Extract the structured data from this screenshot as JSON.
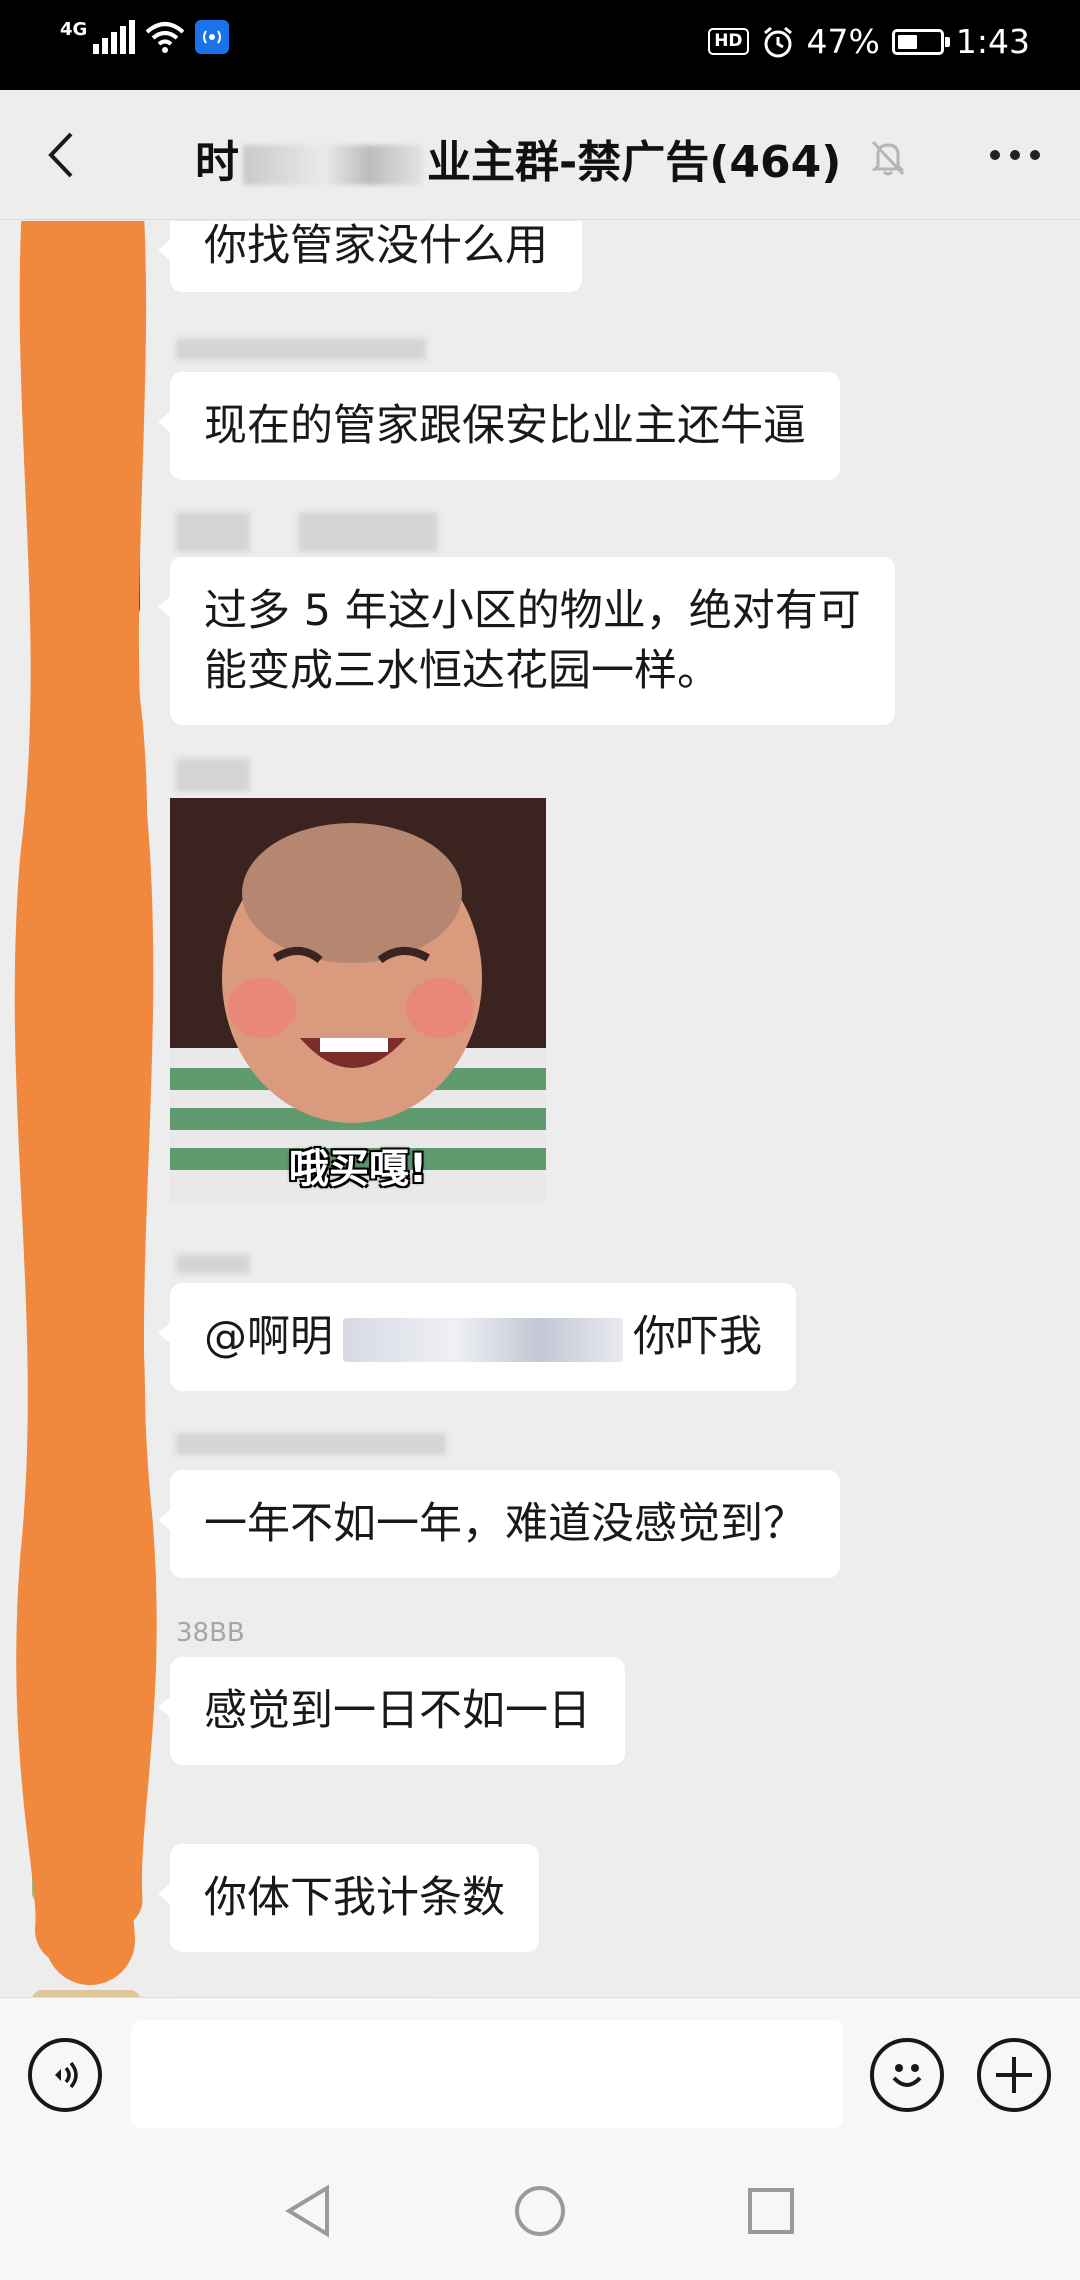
{
  "status_bar": {
    "network": "4G",
    "hd_badge": "HD",
    "battery_percent": "47%",
    "battery_level": 0.47,
    "time": "1:43"
  },
  "header": {
    "title": "时代城业主群-禁广告(464)",
    "title_prefix": "时",
    "title_suffix": "业主群-禁广告(464)",
    "muted": true
  },
  "messages": [
    {
      "sender": "",
      "text": "你找管家没什么用"
    },
    {
      "sender": "",
      "text": "现在的管家跟保安比业主还牛逼"
    },
    {
      "sender": "",
      "text_line1": "过多 5 年这小区的物业，绝对有可",
      "text_line2": "能变成三水恒达花园一样。"
    },
    {
      "sender": "",
      "sticker_caption": "哦买嘎!"
    },
    {
      "sender": "",
      "mention": "@啊明",
      "text": "你吓我"
    },
    {
      "sender": "",
      "text": "一年不如一年，难道没感觉到？"
    },
    {
      "sender": "38BB",
      "text": "感觉到一日不如一日"
    },
    {
      "sender": "",
      "text": "你体下我计条数"
    }
  ],
  "input": {
    "value": "",
    "placeholder": ""
  },
  "colors": {
    "chat_bg": "#ededed",
    "bubble": "#ffffff",
    "status_bar": "#000000",
    "scribble": "#f0893d"
  }
}
